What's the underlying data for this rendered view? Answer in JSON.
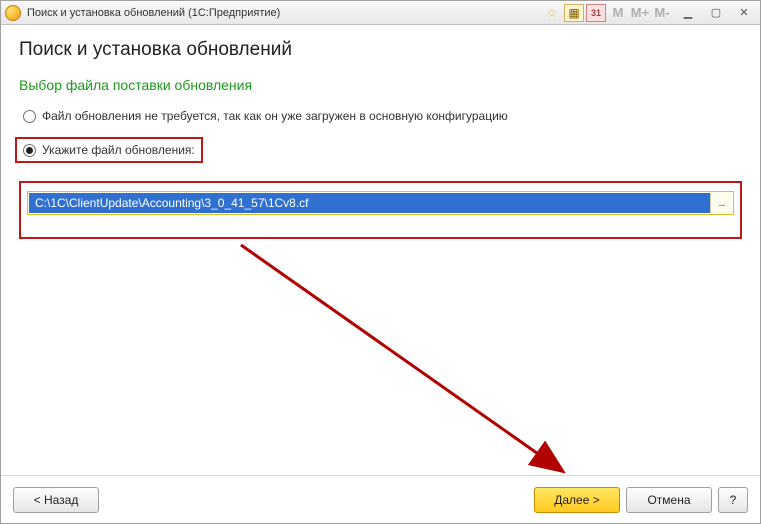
{
  "titlebar": {
    "title": "Поиск и установка обновлений  (1С:Предприятие)",
    "icons": {
      "m1": "M",
      "mplus": "M+",
      "mminus": "M-",
      "cal": "31"
    }
  },
  "page": {
    "title": "Поиск и установка обновлений",
    "subtitle": "Выбор файла поставки обновления"
  },
  "options": {
    "opt1": "Файл обновления не требуется, так как он уже загружен в основную конфигурацию",
    "opt2": "Укажите файл обновления:"
  },
  "path": {
    "value": "C:\\1C\\ClientUpdate\\Accounting\\3_0_41_57\\1Cv8.cf",
    "browse": "..."
  },
  "footer": {
    "back": "< Назад",
    "next": "Далее >",
    "cancel": "Отмена",
    "help": "?"
  }
}
